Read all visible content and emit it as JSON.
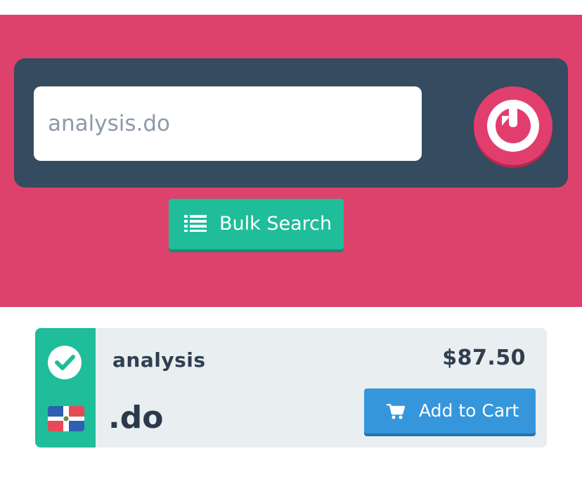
{
  "search": {
    "value": "",
    "placeholder": "analysis.do"
  },
  "bulk_search": {
    "label": "Bulk Search",
    "icon": "list-icon"
  },
  "go_button": {
    "icon": "power-refresh-icon"
  },
  "result": {
    "status": "available",
    "status_icon": "check-circle-icon",
    "flag_icon": "dominican-republic-flag-icon",
    "domain": "analysis",
    "tld": ".do",
    "price": "$87.50",
    "add_to_cart_label": "Add to Cart",
    "cart_icon": "shopping-cart-icon"
  },
  "colors": {
    "hero_background": "#dc426b",
    "search_panel": "#344b60",
    "accent_green": "#1fbd9a",
    "cart_blue": "#3596dc",
    "card_background": "#e9eef0"
  }
}
